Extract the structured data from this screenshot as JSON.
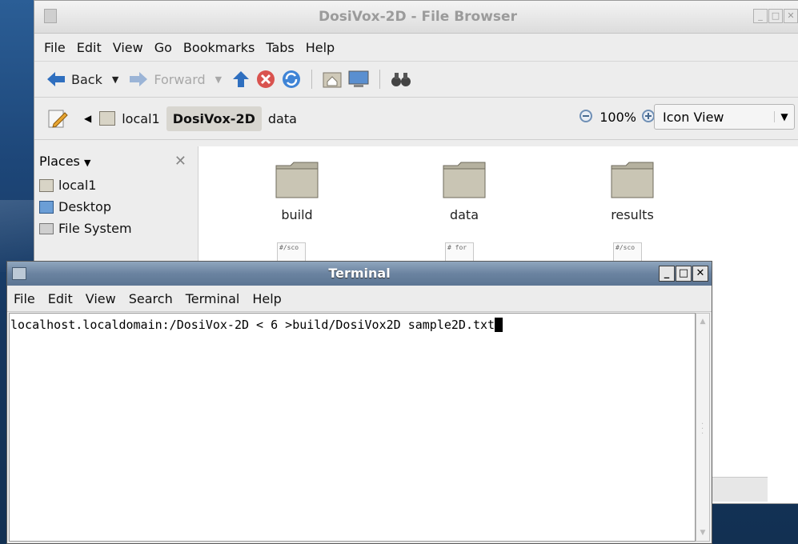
{
  "file_browser": {
    "title": "DosiVox-2D - File Browser",
    "menu": [
      "File",
      "Edit",
      "View",
      "Go",
      "Bookmarks",
      "Tabs",
      "Help"
    ],
    "toolbar": {
      "back": "Back",
      "forward": "Forward"
    },
    "breadcrumb": [
      "local1",
      "DosiVox-2D",
      "data"
    ],
    "zoom": "100%",
    "view_mode": "Icon View",
    "places": {
      "header": "Places",
      "items": [
        "local1",
        "Desktop",
        "File System"
      ]
    },
    "items": [
      {
        "name": "build",
        "kind": "folder"
      },
      {
        "name": "data",
        "kind": "folder"
      },
      {
        "name": "results",
        "kind": "folder"
      }
    ],
    "text_files": [
      {
        "preview": "#/sco"
      },
      {
        "preview": "# for"
      },
      {
        "preview": "#/sco"
      }
    ]
  },
  "terminal": {
    "title": "Terminal",
    "menu": [
      "File",
      "Edit",
      "View",
      "Search",
      "Terminal",
      "Help"
    ],
    "prompt_line": "localhost.localdomain:/DosiVox-2D < 6 >build/DosiVox2D sample2D.txt"
  }
}
